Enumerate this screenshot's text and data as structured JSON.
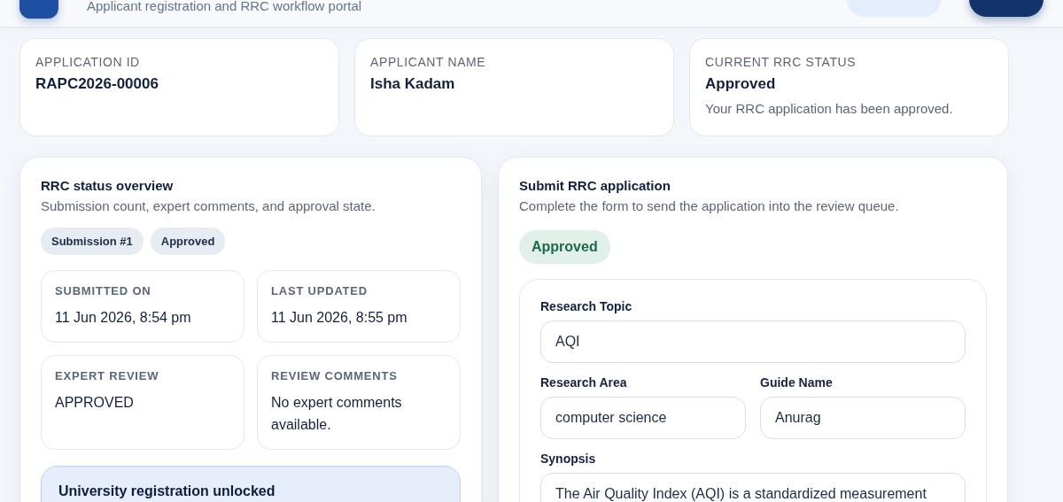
{
  "header": {
    "subtitle": "Applicant registration and RRC workflow portal"
  },
  "summary": [
    {
      "label": "APPLICATION ID",
      "value": "RAPC2026-00006"
    },
    {
      "label": "APPLICANT NAME",
      "value": "Isha Kadam"
    },
    {
      "label": "CURRENT RRC STATUS",
      "value": "Approved",
      "note": "Your RRC application has been approved."
    }
  ],
  "overview": {
    "title": "RRC status overview",
    "subtitle": "Submission count, expert comments, and approval state.",
    "chips": [
      "Submission #1",
      "Approved"
    ],
    "details": [
      {
        "label": "SUBMITTED ON",
        "value": "11 Jun 2026, 8:54 pm"
      },
      {
        "label": "LAST UPDATED",
        "value": "11 Jun 2026, 8:55 pm"
      },
      {
        "label": "EXPERT REVIEW",
        "value": "APPROVED"
      },
      {
        "label": "REVIEW COMMENTS",
        "value": "No expert comments available."
      }
    ],
    "notice": {
      "title": "University registration unlocked"
    }
  },
  "form": {
    "title": "Submit RRC application",
    "subtitle": "Complete the form to send the application into the review queue.",
    "status": "Approved",
    "fields": [
      {
        "label": "Research Topic",
        "value": "AQI",
        "kind": "wide"
      },
      {
        "label": "Research Area",
        "value": "computer science",
        "kind": "half"
      },
      {
        "label": "Guide Name",
        "value": "Anurag",
        "kind": "half"
      },
      {
        "label": "Synopsis",
        "value": "The Air Quality Index (AQI) is a standardized measurement",
        "kind": "textarea"
      }
    ]
  }
}
